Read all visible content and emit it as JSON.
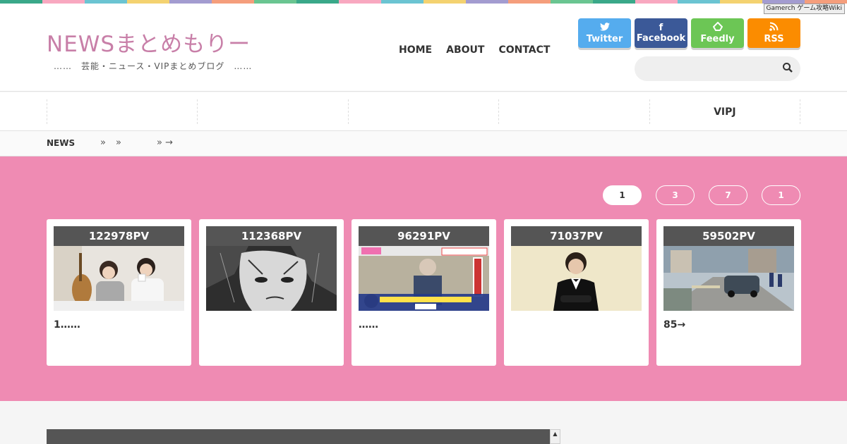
{
  "colors": {
    "stripe": [
      "#3aa889",
      "#f8a8c0",
      "#6bc4d2",
      "#f4d270",
      "#a39cd0",
      "#f59e7c",
      "#6ac591",
      "#3aa889",
      "#f8a8c0",
      "#6bc4d2",
      "#f4d270",
      "#a39cd0",
      "#f59e7c",
      "#6ac591",
      "#3aa889",
      "#f8a8c0",
      "#6bc4d2",
      "#f4d270",
      "#a39cd0",
      "#f59e7c"
    ],
    "twitter": "#55acee",
    "facebook": "#3b5998",
    "feedly": "#6cc655",
    "rss": "#fb8c00",
    "accent_pink": "#ef8bb3"
  },
  "header": {
    "logo": "NEWSまとめもりー",
    "tagline": "……　芸能・ニュース・VIPまとめブログ　……",
    "badge": "Gamerch ゲーム攻略Wiki"
  },
  "nav": {
    "items": [
      "HOME",
      "ABOUT",
      "CONTACT"
    ]
  },
  "social": [
    {
      "label": "Twitter",
      "icon": "twitter-icon",
      "glyph": "🐦"
    },
    {
      "label": "Facebook",
      "icon": "facebook-icon",
      "glyph": "f"
    },
    {
      "label": "Feedly",
      "icon": "feedly-icon",
      "glyph": "◆"
    },
    {
      "label": "RSS",
      "icon": "rss-icon",
      "glyph": ")))"
    }
  ],
  "search": {
    "placeholder": "",
    "icon": "search-icon"
  },
  "categories": [
    "",
    "",
    "",
    "",
    "VIPJ"
  ],
  "breadcrumb": {
    "home": "NEWS",
    "sep1": "»",
    "sep2": "»",
    "sep3": "» →"
  },
  "ranking": {
    "tabs": [
      "1",
      "3",
      "7",
      "1"
    ],
    "active_tab": 0,
    "cards": [
      {
        "pv": "122978PV",
        "title": "1……",
        "thumb": "couple-photo"
      },
      {
        "pv": "112368PV",
        "title": "",
        "thumb": "manga-face"
      },
      {
        "pv": "96291PV",
        "title": "……",
        "thumb": "tv-screenshot"
      },
      {
        "pv": "71037PV",
        "title": "",
        "thumb": "man-in-tuxedo"
      },
      {
        "pv": "59502PV",
        "title": "85→",
        "thumb": "accident-scene"
      }
    ]
  }
}
